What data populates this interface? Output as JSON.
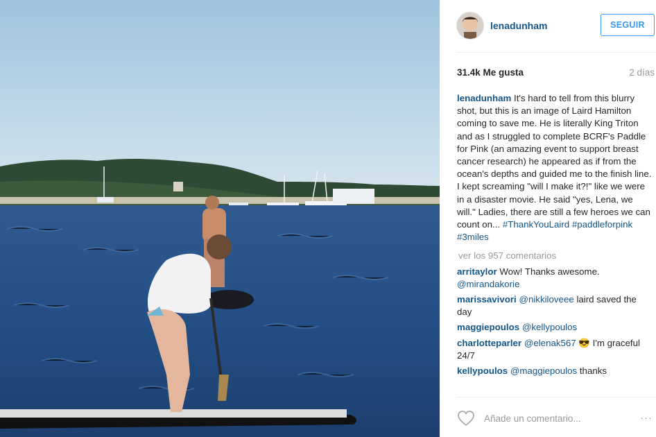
{
  "post": {
    "username": "lenadunham",
    "follow_label": "SEGUIR",
    "likes": "31.4k Me gusta",
    "time_ago": "2 días",
    "caption_user": "lenadunham",
    "caption_text": "It's hard to tell from this blurry shot, but this is an image of Laird Hamilton coming to save me. He is literally King Triton and as I struggled to complete BCRF's Paddle for Pink (an amazing event to support breast cancer research) he appeared as if from the ocean's depths and guided me to the finish line. I kept screaming \"will I make it?!\" like we were in a disaster movie. He said \"yes, Lena, we will.\" Ladies, there are still a few heroes we can count on...",
    "hashtags": [
      "#ThankYouLaird",
      "#paddleforpink",
      "#3miles"
    ],
    "view_comments": "ver los 957 comentarios",
    "comments": [
      {
        "user": "arritaylor",
        "text": "Wow! Thanks awesome.",
        "mention": "@mirandakorie",
        "after": ""
      },
      {
        "user": "marissavivori",
        "text": "",
        "mention": "@nikkiloveee",
        "after": "laird saved the day"
      },
      {
        "user": "maggiepoulos",
        "text": "",
        "mention": "@kellypoulos",
        "after": ""
      },
      {
        "user": "charlotteparler",
        "text": "",
        "mention": "@elenak567",
        "after": "😎 I'm graceful 24/7"
      },
      {
        "user": "kellypoulos",
        "text": "",
        "mention": "@maggiepoulos",
        "after": "thanks"
      }
    ],
    "add_comment_placeholder": "Añade un comentario...",
    "more_label": "···"
  },
  "icons": {
    "like": "heart-icon",
    "options": "more-options-icon"
  },
  "colors": {
    "link": "#125688",
    "follow": "#3897f0",
    "muted": "#999999"
  }
}
